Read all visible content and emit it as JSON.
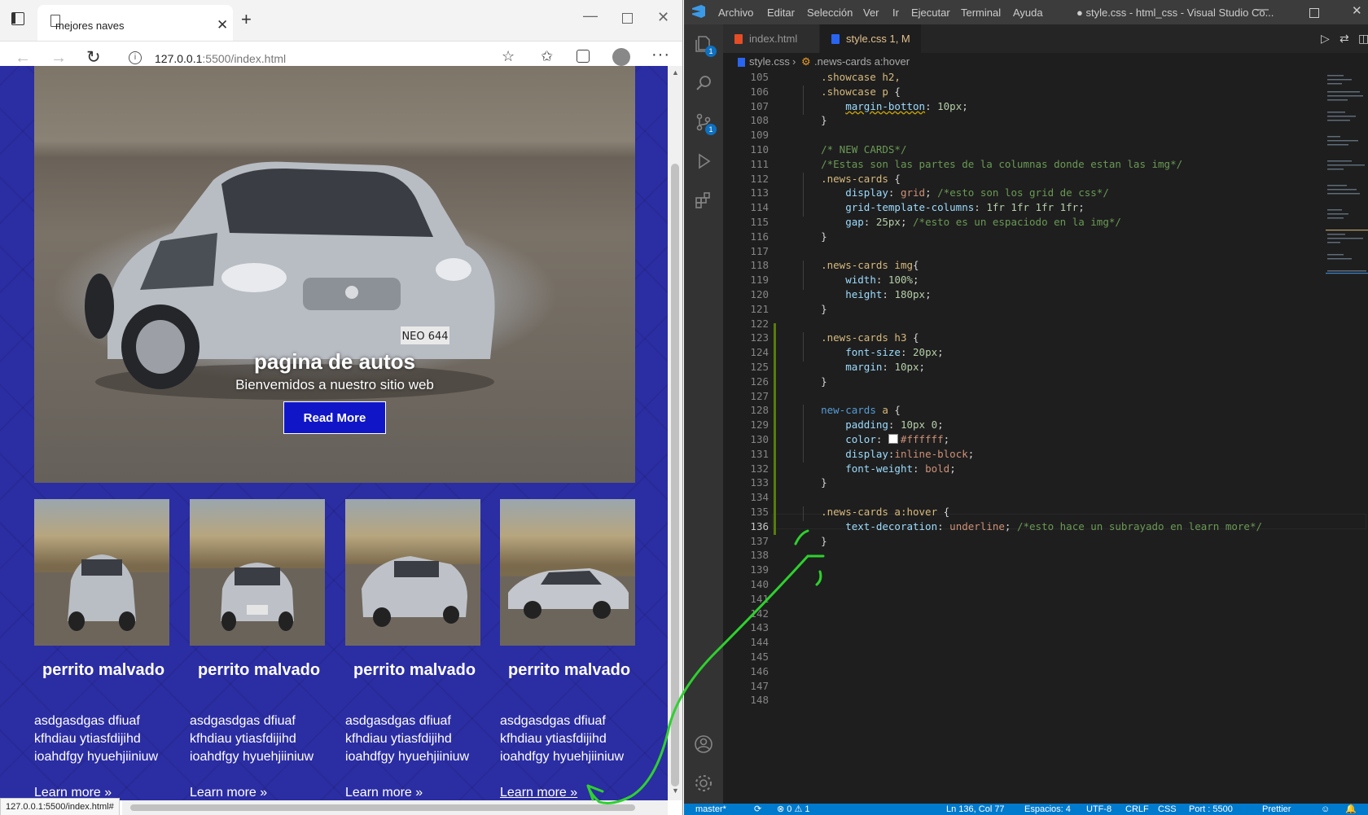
{
  "browser": {
    "tab_title": "mejores naves",
    "url_host": "127.0.0.1",
    "url_rest": ":5500/index.html",
    "status_url": "127.0.0.1:5500/index.html#",
    "page": {
      "hero_title": "pagina de autos",
      "hero_subtitle": "Bienvemidos a nuestro sitio web",
      "read_more": "Read More",
      "cards": [
        {
          "title": "perrito malvado",
          "text": "asdgasdgas dfiuaf kfhdiau ytiasfdijihd ioahdfgy hyuehjiiniuw",
          "link": "Learn more »"
        },
        {
          "title": "perrito malvado",
          "text": "asdgasdgas dfiuaf kfhdiau ytiasfdijihd ioahdfgy hyuehjiiniuw",
          "link": "Learn more »"
        },
        {
          "title": "perrito malvado",
          "text": "asdgasdgas dfiuaf kfhdiau ytiasfdijihd ioahdfgy hyuehjiiniuw",
          "link": "Learn more »"
        },
        {
          "title": "perrito malvado",
          "text": "asdgasdgas dfiuaf kfhdiau ytiasfdijihd ioahdfgy hyuehjiiniuw",
          "link": "Learn more »"
        }
      ],
      "license_plate": "NEO 644"
    }
  },
  "vscode": {
    "menu": [
      "Archivo",
      "Editar",
      "Selección",
      "Ver",
      "Ir",
      "Ejecutar",
      "Terminal",
      "Ayuda"
    ],
    "window_title": "● style.css - html_css - Visual Studio Co...",
    "tabs": [
      {
        "label": "index.html"
      },
      {
        "label": "style.css",
        "status": "1, M"
      }
    ],
    "breadcrumb": {
      "file": "style.css",
      "symbol": ".news-cards a:hover"
    },
    "activity_badges": {
      "explorer": "1",
      "scm": "1"
    },
    "color_swatch": "#ffffff",
    "code_lines": [
      {
        "n": "105",
        "text": "    .showcase h2,"
      },
      {
        "n": "106",
        "text": "    .showcase p {"
      },
      {
        "n": "107",
        "text": "        margin-botton: 10px;"
      },
      {
        "n": "108",
        "text": "    }"
      },
      {
        "n": "109",
        "text": ""
      },
      {
        "n": "110",
        "text": "    /* NEW CARDS*/"
      },
      {
        "n": "111",
        "text": "    /*Estas son las partes de la columnas donde estan las img*/"
      },
      {
        "n": "112",
        "text": "    .news-cards {"
      },
      {
        "n": "113",
        "text": "        display: grid; /*esto son los grid de css*/"
      },
      {
        "n": "114",
        "text": "        grid-template-columns: 1fr 1fr 1fr 1fr;"
      },
      {
        "n": "115",
        "text": "        gap: 25px; /*esto es un espaciodo en la img*/"
      },
      {
        "n": "116",
        "text": "    }"
      },
      {
        "n": "117",
        "text": ""
      },
      {
        "n": "118",
        "text": "    .news-cards img{"
      },
      {
        "n": "119",
        "text": "        width: 100%;"
      },
      {
        "n": "120",
        "text": "        height: 180px;"
      },
      {
        "n": "121",
        "text": "    }"
      },
      {
        "n": "122",
        "text": ""
      },
      {
        "n": "123",
        "text": "    .news-cards h3 {"
      },
      {
        "n": "124",
        "text": "        font-size: 20px;"
      },
      {
        "n": "125",
        "text": "        margin: 10px;"
      },
      {
        "n": "126",
        "text": "    }"
      },
      {
        "n": "127",
        "text": ""
      },
      {
        "n": "128",
        "text": "    new-cards a {"
      },
      {
        "n": "129",
        "text": "        padding: 10px 0;"
      },
      {
        "n": "130",
        "text": "        color: #ffffff;"
      },
      {
        "n": "131",
        "text": "        display:inline-block;"
      },
      {
        "n": "132",
        "text": "        font-weight: bold;"
      },
      {
        "n": "133",
        "text": "    }"
      },
      {
        "n": "134",
        "text": ""
      },
      {
        "n": "135",
        "text": "    .news-cards a:hover {"
      },
      {
        "n": "136",
        "text": "        text-decoration: underline; /*esto hace un subrayado en learn more*/"
      },
      {
        "n": "137",
        "text": "    }"
      },
      {
        "n": "138",
        "text": ""
      },
      {
        "n": "139",
        "text": ""
      },
      {
        "n": "140",
        "text": ""
      },
      {
        "n": "141",
        "text": ""
      },
      {
        "n": "142",
        "text": ""
      },
      {
        "n": "143",
        "text": ""
      },
      {
        "n": "144",
        "text": ""
      },
      {
        "n": "145",
        "text": ""
      },
      {
        "n": "146",
        "text": ""
      },
      {
        "n": "147",
        "text": ""
      },
      {
        "n": "148",
        "text": ""
      }
    ],
    "status_bar": {
      "branch": "master*",
      "problems": "⊗ 0 ⚠ 1",
      "position": "Ln 136, Col 77",
      "spaces": "Espacios: 4",
      "encoding": "UTF-8",
      "eol": "CRLF",
      "language": "CSS",
      "port": "Port : 5500",
      "prettier": "Prettier"
    },
    "colors": {
      "accent": "#007acc",
      "annotation": "#2ed12e"
    }
  }
}
